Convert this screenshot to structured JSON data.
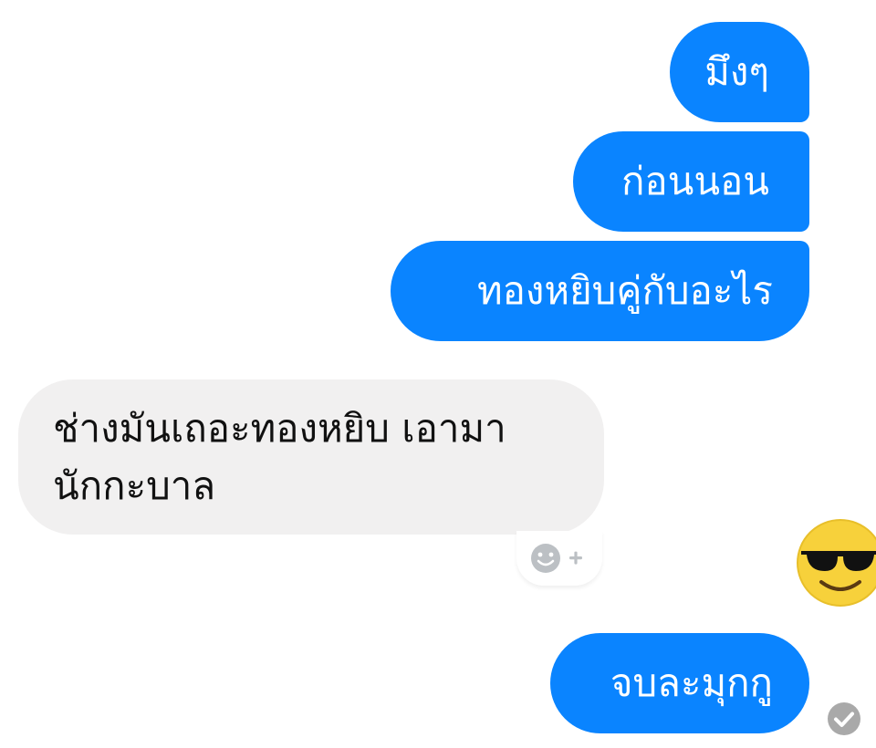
{
  "conversation": {
    "messages": [
      {
        "direction": "outgoing",
        "text": "มึงๆ"
      },
      {
        "direction": "outgoing",
        "text": "ก่อนนอน"
      },
      {
        "direction": "outgoing",
        "text": "ทองหยิบคู่กับอะไร"
      },
      {
        "direction": "incoming",
        "text": "ช่างมันเถอะทองหยิบ เอามานักกะบาล"
      },
      {
        "direction": "outgoing",
        "text": "จบละมุกกู"
      }
    ]
  },
  "icons": {
    "reaction_button": "smiley-plus-icon",
    "seen_avatar": "sunglasses-emoji-icon",
    "read_receipt": "check-circle-icon"
  },
  "colors": {
    "outgoing_bubble": "#0a84ff",
    "incoming_bubble": "#f1f0f0",
    "outgoing_text": "#ffffff",
    "incoming_text": "#111111",
    "emoji_face": "#f7d13b",
    "read_receipt": "#a9a9a9"
  }
}
